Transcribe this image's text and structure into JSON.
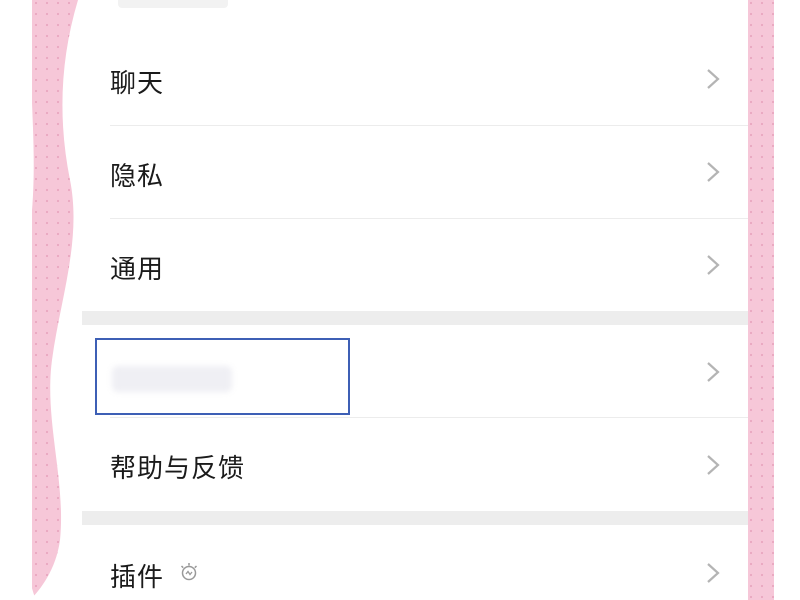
{
  "settings": {
    "items": [
      {
        "label": "聊天"
      },
      {
        "label": "隐私"
      },
      {
        "label": "通用"
      },
      {
        "label": ""
      },
      {
        "label": "帮助与反馈"
      },
      {
        "label": "插件"
      }
    ]
  },
  "icons": {
    "chevron": "chevron-right-icon",
    "plugin_badge": "bulb-icon"
  },
  "colors": {
    "wallpaper_pink": "#f7c9da",
    "selection_border": "#3d5fb5",
    "section_gap": "#ededed"
  }
}
